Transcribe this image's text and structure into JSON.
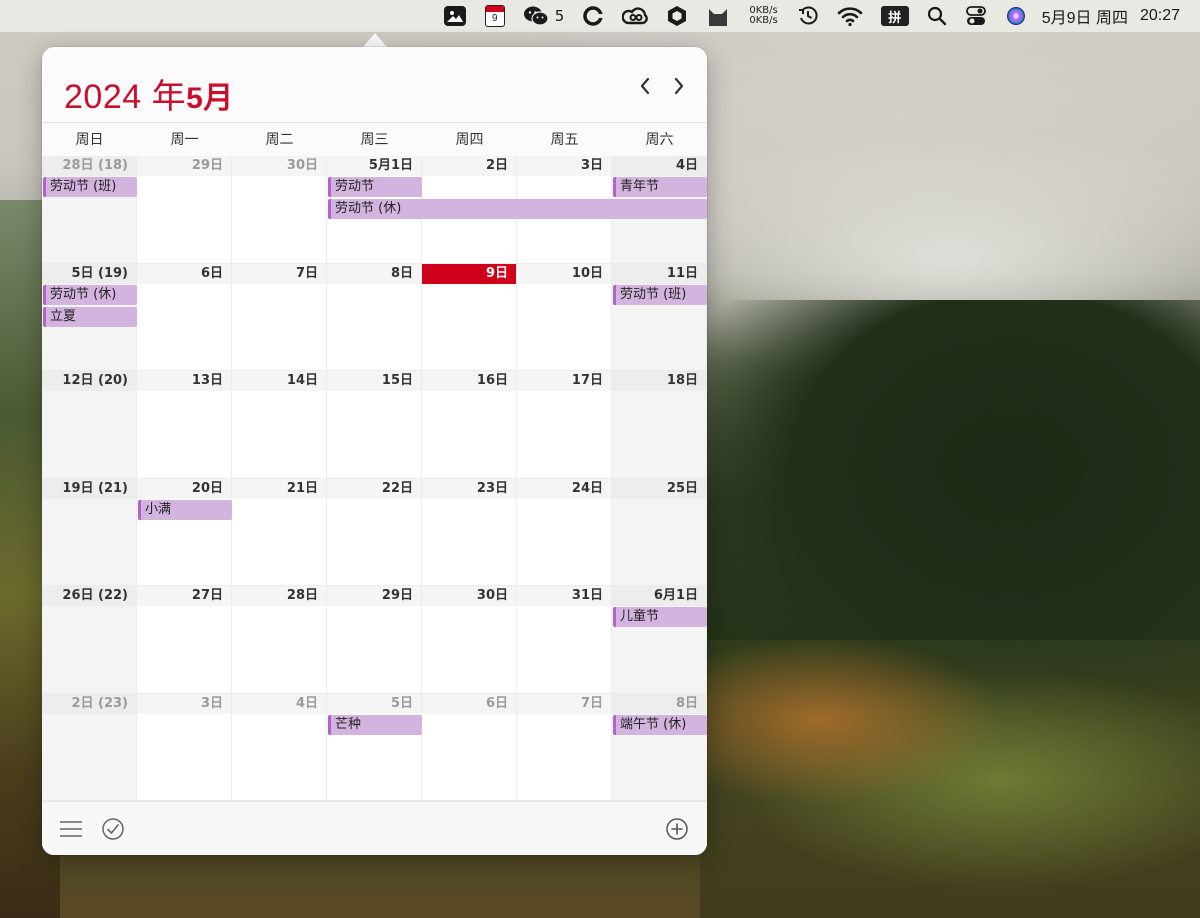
{
  "menubar": {
    "wechat_badge": "5",
    "net_up": "0KB/s",
    "net_down": "0KB/s",
    "calendar_day": "9",
    "input_method": "拼",
    "date": "5月9日 周四",
    "time": "20:27"
  },
  "calendar": {
    "title_year": "2024 年",
    "title_month": "5月",
    "accent_color": "#c8102e",
    "event_color": "#d3b4df",
    "weekdays": [
      "周日",
      "周一",
      "周二",
      "周三",
      "周四",
      "周五",
      "周六"
    ],
    "weeks": [
      [
        "28日 (18)",
        "29日",
        "30日",
        "5月1日",
        "2日",
        "3日",
        "4日"
      ],
      [
        "5日 (19)",
        "6日",
        "7日",
        "8日",
        "9日",
        "10日",
        "11日"
      ],
      [
        "12日 (20)",
        "13日",
        "14日",
        "15日",
        "16日",
        "17日",
        "18日"
      ],
      [
        "19日 (21)",
        "20日",
        "21日",
        "22日",
        "23日",
        "24日",
        "25日"
      ],
      [
        "26日 (22)",
        "27日",
        "28日",
        "29日",
        "30日",
        "31日",
        "6月1日"
      ],
      [
        "2日 (23)",
        "3日",
        "4日",
        "5日",
        "6日",
        "7日",
        "8日"
      ]
    ],
    "other_month_cells": [
      [
        0,
        0
      ],
      [
        0,
        1
      ],
      [
        0,
        2
      ],
      [
        5,
        0
      ],
      [
        5,
        1
      ],
      [
        5,
        2
      ],
      [
        5,
        3
      ],
      [
        5,
        4
      ],
      [
        5,
        5
      ],
      [
        5,
        6
      ]
    ],
    "today_cell": [
      1,
      4
    ],
    "events": [
      {
        "label": "劳动节 (班)",
        "week": 0,
        "start": 0,
        "span": 1,
        "slot": 0
      },
      {
        "label": "劳动节",
        "week": 0,
        "start": 3,
        "span": 1,
        "slot": 0
      },
      {
        "label": "青年节",
        "week": 0,
        "start": 6,
        "span": 1,
        "slot": 0
      },
      {
        "label": "劳动节 (休)",
        "week": 0,
        "start": 3,
        "span": 4,
        "slot": 1
      },
      {
        "label": "劳动节 (休)",
        "week": 1,
        "start": 0,
        "span": 1,
        "slot": 0
      },
      {
        "label": "立夏",
        "week": 1,
        "start": 0,
        "span": 1,
        "slot": 1
      },
      {
        "label": "劳动节 (班)",
        "week": 1,
        "start": 6,
        "span": 1,
        "slot": 0
      },
      {
        "label": "小满",
        "week": 3,
        "start": 1,
        "span": 1,
        "slot": 0
      },
      {
        "label": "儿童节",
        "week": 4,
        "start": 6,
        "span": 1,
        "slot": 0
      },
      {
        "label": "芒种",
        "week": 5,
        "start": 3,
        "span": 1,
        "slot": 0
      },
      {
        "label": "端午节 (休)",
        "week": 5,
        "start": 6,
        "span": 1,
        "slot": 0
      }
    ]
  }
}
